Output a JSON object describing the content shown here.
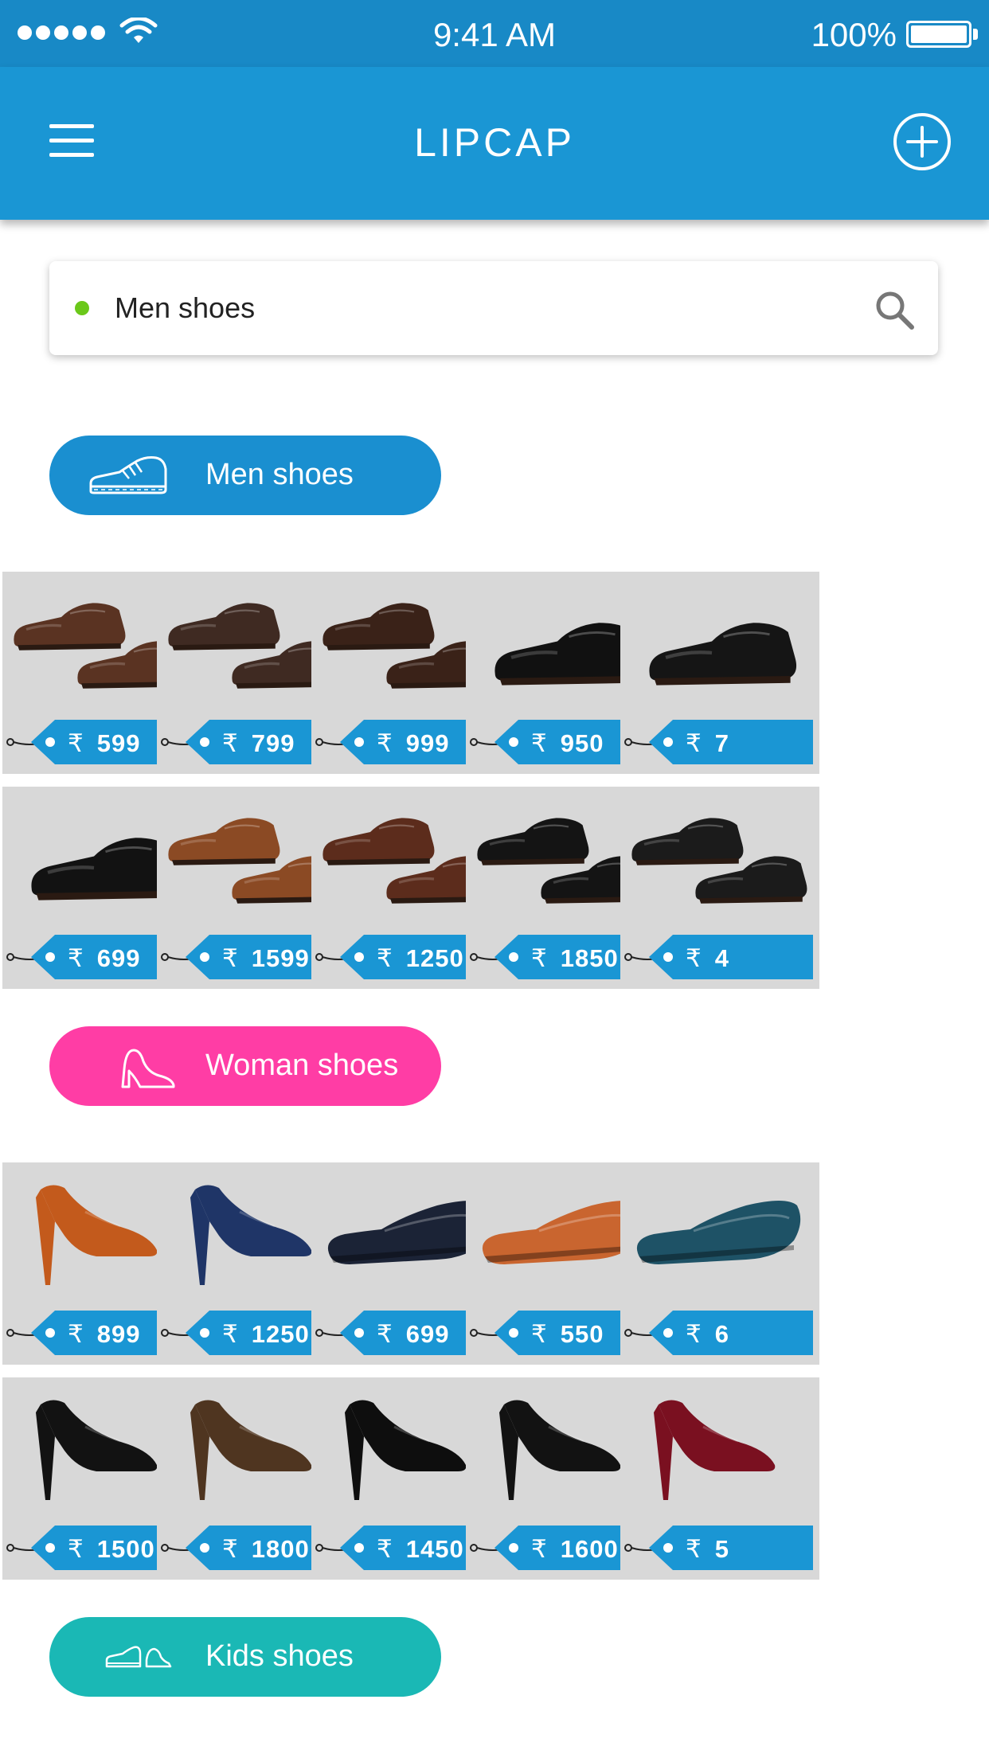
{
  "status_bar": {
    "time": "9:41 AM",
    "battery": "100%"
  },
  "nav": {
    "title": "LIPCAP"
  },
  "search": {
    "value": "Men shoes",
    "placeholder": "Search"
  },
  "currency": "₹",
  "sections": [
    {
      "label": "Men shoes",
      "color": "#1a8fd0",
      "icon": "sneaker-icon",
      "rows": [
        [
          {
            "price": "599",
            "style": "brown-brogue"
          },
          {
            "price": "799",
            "style": "dark-brown-derby"
          },
          {
            "price": "999",
            "style": "brown-wingtip"
          },
          {
            "price": "950",
            "style": "black-oxford"
          },
          {
            "price": "7",
            "style": "black-derby"
          }
        ],
        [
          {
            "price": "699",
            "style": "black-captoe"
          },
          {
            "price": "1599",
            "style": "tan-casual"
          },
          {
            "price": "1250",
            "style": "brown-captoe"
          },
          {
            "price": "1850",
            "style": "black-wingtip"
          },
          {
            "price": "4",
            "style": "black-derby-2"
          }
        ]
      ]
    },
    {
      "label": "Woman shoes",
      "color": "#ff3da5",
      "icon": "high-heel-icon",
      "rows": [
        [
          {
            "price": "899",
            "style": "tan-kitten-heel"
          },
          {
            "price": "1250",
            "style": "navy-block-pump"
          },
          {
            "price": "699",
            "style": "navy-ballet-flat"
          },
          {
            "price": "550",
            "style": "tan-laser-flat"
          },
          {
            "price": "6",
            "style": "teal-pump"
          }
        ],
        [
          {
            "price": "1500",
            "style": "black-strap-stiletto"
          },
          {
            "price": "1800",
            "style": "brown-oxford-heel"
          },
          {
            "price": "1450",
            "style": "black-peeptoe"
          },
          {
            "price": "1600",
            "style": "black-strap-stiletto-2"
          },
          {
            "price": "5",
            "style": "red-stiletto"
          }
        ]
      ]
    },
    {
      "label": "Kids shoes",
      "color": "#1ab8b5",
      "icon": "kids-shoes-icon",
      "rows": []
    }
  ]
}
